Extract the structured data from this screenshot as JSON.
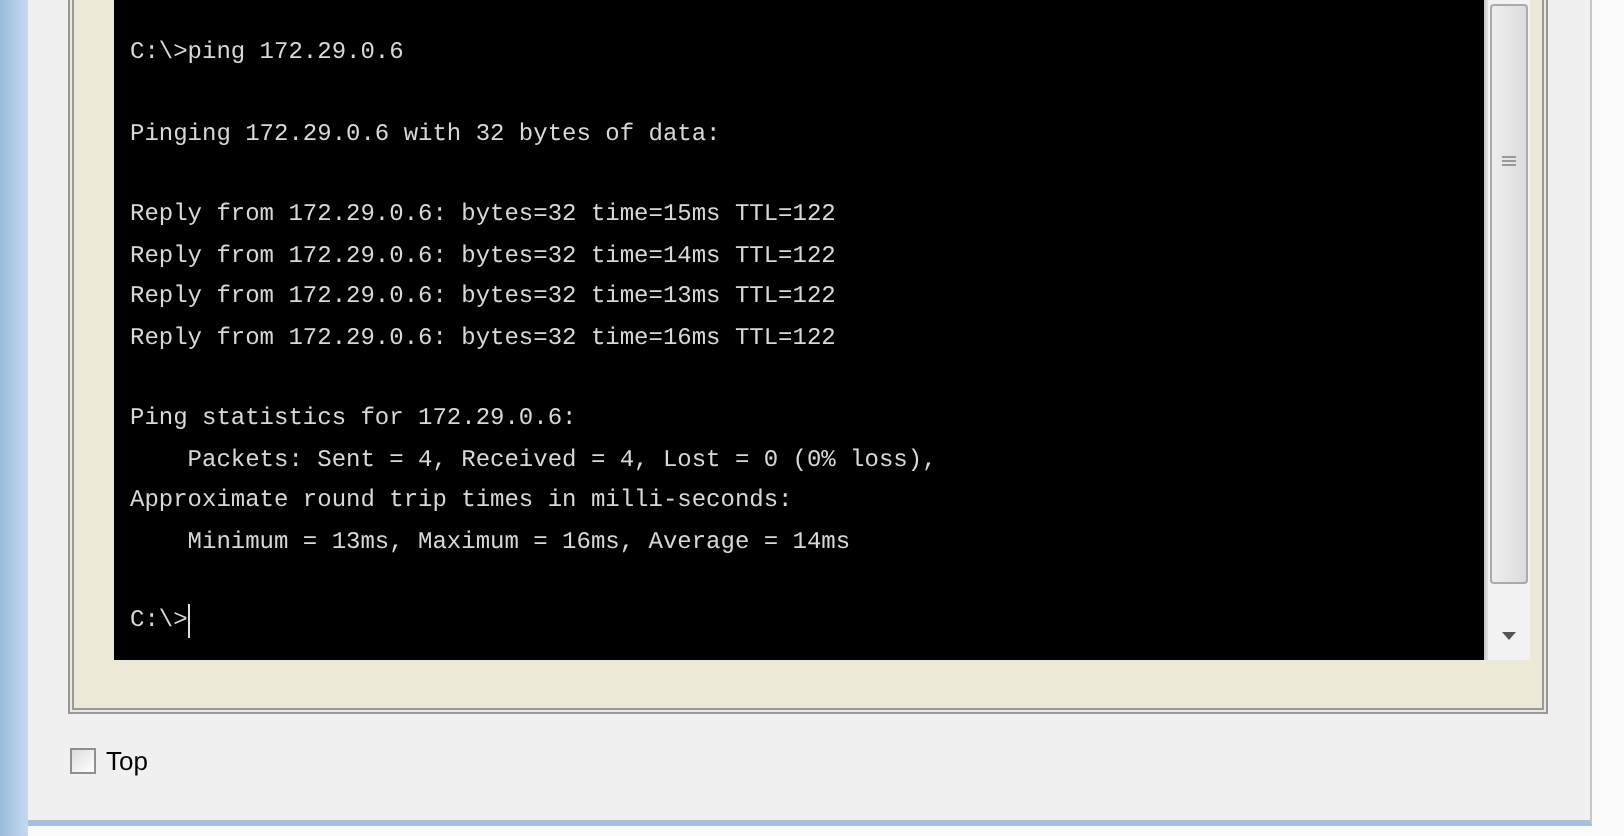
{
  "terminal": {
    "blocks": [
      [
        "C:\\>ping 172.29.0.6"
      ],
      [
        "Pinging 172.29.0.6 with 32 bytes of data:"
      ],
      [
        "Reply from 172.29.0.6: bytes=32 time=15ms TTL=122",
        "Reply from 172.29.0.6: bytes=32 time=14ms TTL=122",
        "Reply from 172.29.0.6: bytes=32 time=13ms TTL=122",
        "Reply from 172.29.0.6: bytes=32 time=16ms TTL=122"
      ],
      [
        "Ping statistics for 172.29.0.6:",
        "    Packets: Sent = 4, Received = 4, Lost = 0 (0% loss),",
        "Approximate round trip times in milli-seconds:",
        "    Minimum = 13ms, Maximum = 16ms, Average = 14ms"
      ]
    ],
    "prompt": "C:\\>"
  },
  "top_checkbox": {
    "label": "Top",
    "checked": false
  }
}
